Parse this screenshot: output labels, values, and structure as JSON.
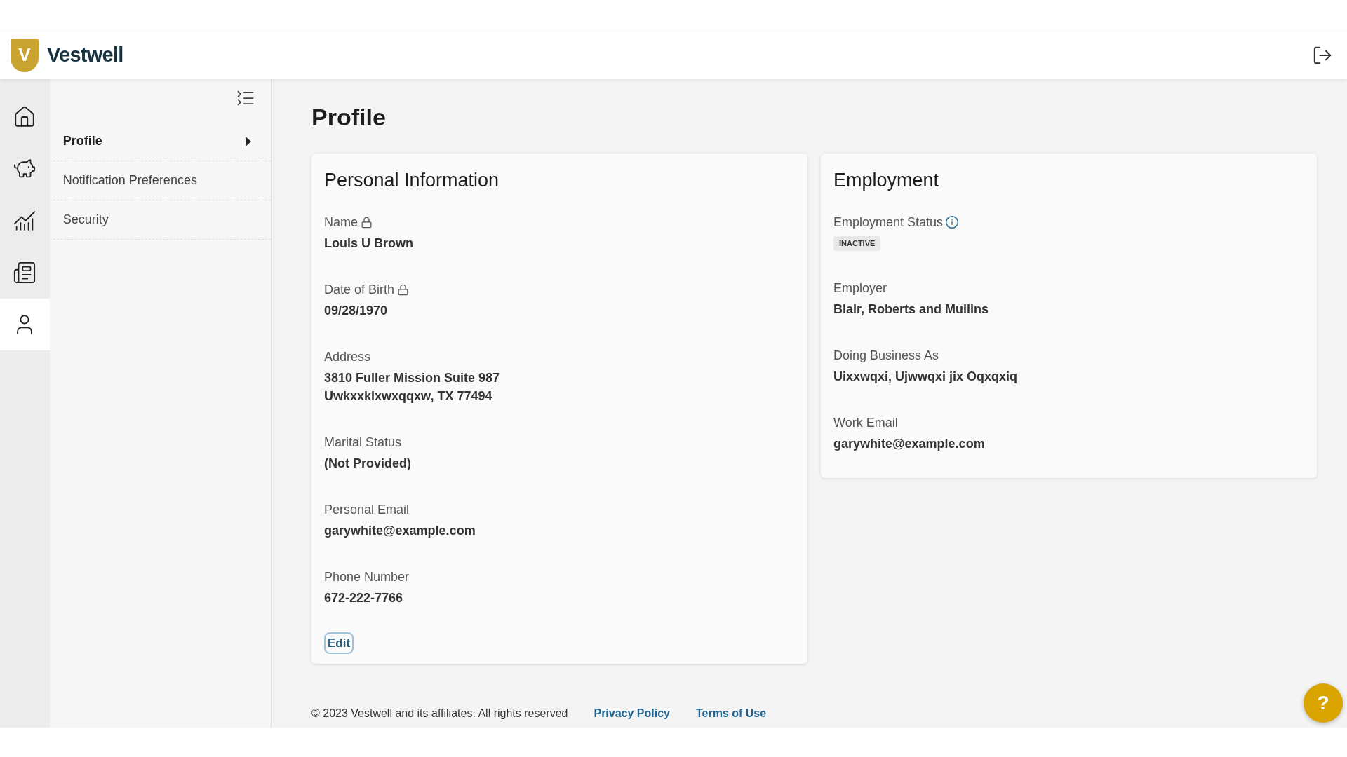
{
  "brand": {
    "mark": "V",
    "name": "Vestwell"
  },
  "rail": [
    {
      "kind": "home",
      "selected": false
    },
    {
      "kind": "piggy",
      "selected": false
    },
    {
      "kind": "chart",
      "selected": false
    },
    {
      "kind": "document",
      "selected": false
    },
    {
      "kind": "person",
      "selected": true
    }
  ],
  "submenu": [
    {
      "label": "Profile",
      "selected": true
    },
    {
      "label": "Notification Preferences",
      "selected": false
    },
    {
      "label": "Security",
      "selected": false
    }
  ],
  "page_title": "Profile",
  "personal": {
    "title": "Personal Information",
    "fields": [
      {
        "label": "Name",
        "locked": true,
        "lines": [
          "Louis U Brown"
        ]
      },
      {
        "label": "Date of Birth",
        "locked": true,
        "lines": [
          "09/28/1970"
        ]
      },
      {
        "label": "Address",
        "locked": false,
        "lines": [
          "3810 Fuller Mission Suite 987",
          "Uwkxxkixwxqqxw, TX 77494"
        ]
      },
      {
        "label": "Marital Status",
        "locked": false,
        "lines": [
          "(Not Provided)"
        ]
      },
      {
        "label": "Personal Email",
        "locked": false,
        "lines": [
          "garywhite@example.com"
        ]
      },
      {
        "label": "Phone Number",
        "locked": false,
        "lines": [
          "672-222-7766"
        ]
      }
    ],
    "edit_button": "Edit"
  },
  "employment": {
    "title": "Employment",
    "fields": [
      {
        "label": "Employment Status",
        "info": true,
        "kind": "badge",
        "value": "INACTIVE"
      },
      {
        "label": "Employer",
        "info": false,
        "kind": "text",
        "value": "Blair, Roberts and Mullins"
      },
      {
        "label": "Doing Business As",
        "info": false,
        "kind": "text",
        "value": "Uixxwqxi, Ujwwqxi jix Oqxqxiq"
      },
      {
        "label": "Work Email",
        "info": false,
        "kind": "text",
        "value": "garywhite@example.com"
      }
    ]
  },
  "footer": {
    "copyright": "© 2023 Vestwell and its affiliates. All rights reserved",
    "links": [
      "Privacy Policy",
      "Terms of Use"
    ]
  },
  "help_button": "?"
}
